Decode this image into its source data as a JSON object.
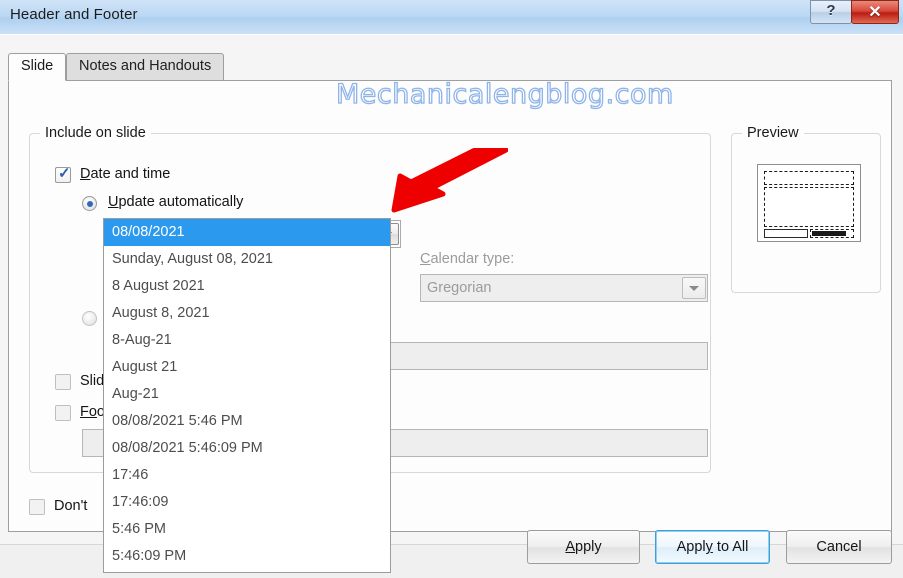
{
  "window": {
    "title": "Header and Footer",
    "help_glyph": "?",
    "close_glyph": "✕"
  },
  "tabs": [
    {
      "label": "Slide",
      "active": true
    },
    {
      "label": "Notes and Handouts",
      "active": false
    }
  ],
  "include_group": {
    "title": "Include on slide",
    "date_and_time": {
      "label": "Date and time",
      "checked": true,
      "accesskey_prefix": "D",
      "accesskey_rest": "ate and time"
    },
    "update_automatically": {
      "label": "Update automatically",
      "selected": true,
      "accesskey_prefix": "U",
      "accesskey_rest": "pdate automatically"
    },
    "date_combo": {
      "value": "08/08/2021",
      "expanded": true
    },
    "calendar_type": {
      "label": "Calendar type:",
      "accesskey_prefix": "C",
      "accesskey_rest": "alendar type:",
      "value": "Gregorian",
      "disabled": true
    },
    "fixed": {
      "label": "",
      "selected": false,
      "disabled": true
    },
    "fixed_field": {
      "value": "",
      "disabled": true
    },
    "slide_number": {
      "label": "Slid",
      "checked": false
    },
    "footer": {
      "label": "Foo",
      "accesskey_prefix": "Fo",
      "accesskey_rest": "o",
      "checked": false
    },
    "footer_field": {
      "value": "",
      "disabled": true
    }
  },
  "dont_show": {
    "label": "Don't",
    "checked": false
  },
  "date_options": [
    "08/08/2021",
    "Sunday, August 08, 2021",
    "8 August 2021",
    "August 8, 2021",
    "8-Aug-21",
    "August 21",
    "Aug-21",
    "08/08/2021 5:46 PM",
    "08/08/2021 5:46:09 PM",
    "17:46",
    "17:46:09",
    "5:46 PM",
    "5:46:09 PM"
  ],
  "selected_date_option": "08/08/2021",
  "preview": {
    "title": "Preview"
  },
  "buttons": {
    "apply": "Apply",
    "apply_prefix": "A",
    "apply_rest": "pply",
    "apply_to_all": "Apply to All",
    "apply_to_all_pre": "Appl",
    "apply_to_all_key": "y",
    "apply_to_all_post": " to All",
    "cancel": "Cancel"
  },
  "watermark": {
    "text": "Mechanicalengblog.com",
    "color": "#8fb4e8"
  },
  "annotation": {
    "arrow_color": "#EE0000",
    "points_at": "date-format-dropdown-arrow"
  }
}
